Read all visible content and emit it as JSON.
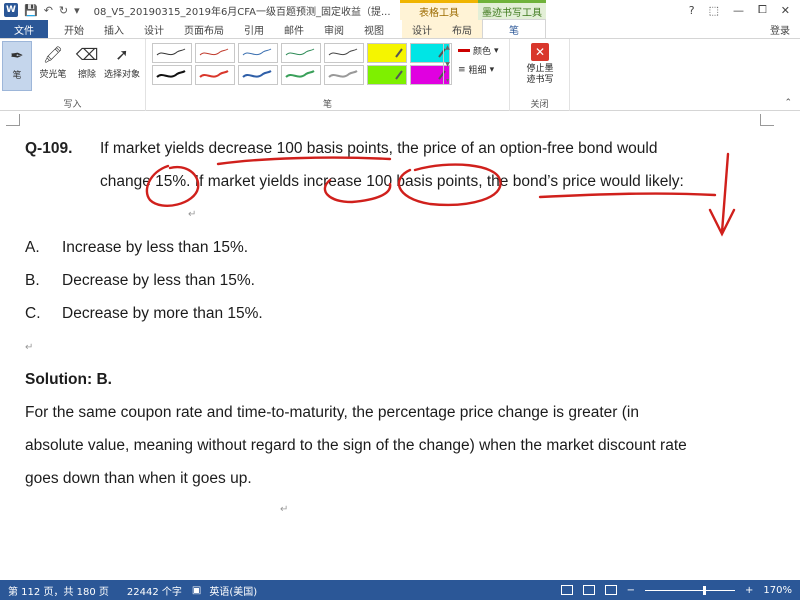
{
  "titlebar": {
    "app_icon": "W",
    "quick_access": [
      "save-icon",
      "undo-icon",
      "redo-icon",
      "customize-icon"
    ],
    "doc_title": "08_V5_20190315_2019年6月CFA一级百题预测_固定收益（提...",
    "ctx_table_group": "表格工具",
    "ctx_ink_group": "墨迹书写工具",
    "controls": [
      "?",
      "⬚",
      "—",
      "⧠",
      "✕"
    ]
  },
  "tabs": {
    "file": "文件",
    "items": [
      "开始",
      "插入",
      "设计",
      "页面布局",
      "引用",
      "邮件",
      "审阅",
      "视图"
    ],
    "table_design": "设计",
    "table_layout": "布局",
    "pen": "笔",
    "login": "登录"
  },
  "ribbon": {
    "write_group": {
      "label": "写入",
      "pen": "笔",
      "highlighter": "荧光笔",
      "eraser": "擦除",
      "select": "选择对象"
    },
    "pen_group": {
      "label": "笔",
      "color": "颜色",
      "thickness": "粗细",
      "pens_row1": [
        "#333333",
        "#c0392b",
        "#3a6fb0",
        "#2e8b57",
        "#444444",
        "#f5f500",
        "#00e5e5"
      ],
      "pens_row2": [
        "#111111",
        "#d9372c",
        "#2f5fa8",
        "#3aa05a",
        "#999999",
        "#7ef000",
        "#e000e0"
      ]
    },
    "close_group": {
      "label": "关闭",
      "stop": "停止墨迹书写"
    }
  },
  "document": {
    "question_number": "Q-109.",
    "question_line1": "If market yields decrease 100 basis points, the price of an option-free bond would",
    "question_line2": "change 15%. If market yields increase 100 basis points, the bond’s price would likely:",
    "option_a_letter": "A.",
    "option_a": "Increase by less than 15%.",
    "option_b_letter": "B.",
    "option_b": "Decrease by less than 15%.",
    "option_c_letter": "C.",
    "option_c": "Decrease by more than 15%.",
    "solution": "Solution: B.",
    "explanation_line1": "For the same coupon rate and time-to-maturity, the percentage price change is greater (in",
    "explanation_line2": "absolute value, meaning without regard to the sign of the change) when the market discount rate",
    "explanation_line3": "goes down than when it goes up.",
    "para_mark": "↵",
    "ink_color": "#d0201c"
  },
  "statusbar": {
    "page": "第 112 页，共 180 页",
    "words": "22442 个字",
    "language": "英语(美国)",
    "zoom": "170%",
    "zoom_minus": "−",
    "zoom_plus": "+"
  }
}
